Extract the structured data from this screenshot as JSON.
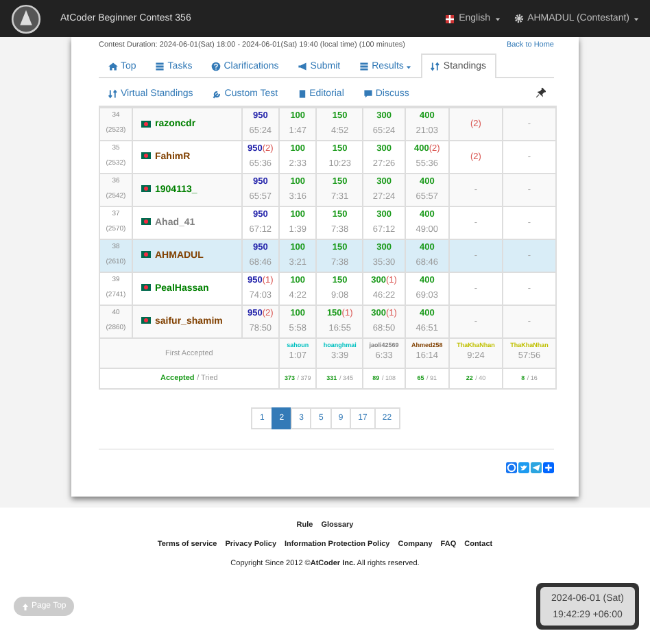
{
  "navbar": {
    "title": "AtCoder Beginner Contest 356",
    "language": "English",
    "user": "AHMADUL (Contestant)"
  },
  "contest_duration": "Contest Duration: 2024-06-01(Sat) 18:00 - 2024-06-01(Sat) 19:40 (local time) (100 minutes)",
  "back_link": "Back to Home",
  "tabs": [
    {
      "label": "Top",
      "kind": "home",
      "selected": false,
      "dropdown": false
    },
    {
      "label": "Tasks",
      "kind": "list",
      "selected": false,
      "dropdown": false
    },
    {
      "label": "Clarifications",
      "kind": "question",
      "selected": false,
      "dropdown": false
    },
    {
      "label": "Submit",
      "kind": "send",
      "selected": false,
      "dropdown": false
    },
    {
      "label": "Results",
      "kind": "list",
      "selected": false,
      "dropdown": true
    },
    {
      "label": "Standings",
      "kind": "sort",
      "selected": true,
      "dropdown": false
    }
  ],
  "subtabs": [
    {
      "label": "Virtual Standings",
      "kind": "sort"
    },
    {
      "label": "Custom Test",
      "kind": "wrench"
    },
    {
      "label": "Editorial",
      "kind": "book"
    },
    {
      "label": "Discuss",
      "kind": "comment"
    }
  ],
  "rows": [
    {
      "rank": "34",
      "rating": "(2523)",
      "user": "razoncdr",
      "color": "#008000",
      "highlighted": false,
      "total": {
        "score": "950",
        "time": "65:24"
      },
      "tasks": [
        {
          "kind": "solved",
          "score": "100",
          "time": "1:47"
        },
        {
          "kind": "solved",
          "score": "150",
          "time": "4:52"
        },
        {
          "kind": "solved",
          "score": "300",
          "time": "65:24"
        },
        {
          "kind": "solved",
          "score": "400",
          "time": "21:03"
        },
        {
          "kind": "tried",
          "penalty": "(2)"
        },
        {
          "kind": "none",
          "text": "-"
        }
      ]
    },
    {
      "rank": "35",
      "rating": "(2532)",
      "user": "FahimR",
      "color": "#804000",
      "highlighted": false,
      "total": {
        "score": "950",
        "penalty": "(2)",
        "time": "65:36"
      },
      "tasks": [
        {
          "kind": "solved",
          "score": "100",
          "time": "2:33"
        },
        {
          "kind": "solved",
          "score": "150",
          "time": "10:23"
        },
        {
          "kind": "solved",
          "score": "300",
          "time": "27:26"
        },
        {
          "kind": "solved",
          "score": "400",
          "penalty": "(2)",
          "time": "55:36"
        },
        {
          "kind": "tried",
          "penalty": "(2)"
        },
        {
          "kind": "none",
          "text": "-"
        }
      ]
    },
    {
      "rank": "36",
      "rating": "(2542)",
      "user": "1904113_",
      "color": "#008000",
      "highlighted": false,
      "total": {
        "score": "950",
        "time": "65:57"
      },
      "tasks": [
        {
          "kind": "solved",
          "score": "100",
          "time": "3:16"
        },
        {
          "kind": "solved",
          "score": "150",
          "time": "7:31"
        },
        {
          "kind": "solved",
          "score": "300",
          "time": "27:24"
        },
        {
          "kind": "solved",
          "score": "400",
          "time": "65:57"
        },
        {
          "kind": "none",
          "text": "-"
        },
        {
          "kind": "none",
          "text": "-"
        }
      ]
    },
    {
      "rank": "37",
      "rating": "(2570)",
      "user": "Ahad_41",
      "color": "#808080",
      "highlighted": false,
      "total": {
        "score": "950",
        "time": "67:12"
      },
      "tasks": [
        {
          "kind": "solved",
          "score": "100",
          "time": "1:39"
        },
        {
          "kind": "solved",
          "score": "150",
          "time": "7:38"
        },
        {
          "kind": "solved",
          "score": "300",
          "time": "67:12"
        },
        {
          "kind": "solved",
          "score": "400",
          "time": "49:00"
        },
        {
          "kind": "none",
          "text": "-"
        },
        {
          "kind": "none",
          "text": "-"
        }
      ]
    },
    {
      "rank": "38",
      "rating": "(2610)",
      "user": "AHMADUL",
      "color": "#804000",
      "highlighted": true,
      "total": {
        "score": "950",
        "time": "68:46"
      },
      "tasks": [
        {
          "kind": "solved",
          "score": "100",
          "time": "3:21"
        },
        {
          "kind": "solved",
          "score": "150",
          "time": "7:38"
        },
        {
          "kind": "solved",
          "score": "300",
          "time": "35:30"
        },
        {
          "kind": "solved",
          "score": "400",
          "time": "68:46"
        },
        {
          "kind": "none",
          "text": "-"
        },
        {
          "kind": "none",
          "text": "-"
        }
      ]
    },
    {
      "rank": "39",
      "rating": "(2741)",
      "user": "PealHassan",
      "color": "#008000",
      "highlighted": false,
      "total": {
        "score": "950",
        "penalty": "(1)",
        "time": "74:03"
      },
      "tasks": [
        {
          "kind": "solved",
          "score": "100",
          "time": "4:22"
        },
        {
          "kind": "solved",
          "score": "150",
          "time": "9:08"
        },
        {
          "kind": "solved",
          "score": "300",
          "penalty": "(1)",
          "time": "46:22"
        },
        {
          "kind": "solved",
          "score": "400",
          "time": "69:03"
        },
        {
          "kind": "none",
          "text": "-"
        },
        {
          "kind": "none",
          "text": "-"
        }
      ]
    },
    {
      "rank": "40",
      "rating": "(2860)",
      "user": "saifur_shamim",
      "color": "#804000",
      "highlighted": false,
      "total": {
        "score": "950",
        "penalty": "(2)",
        "time": "78:50"
      },
      "tasks": [
        {
          "kind": "solved",
          "score": "100",
          "time": "5:58"
        },
        {
          "kind": "solved",
          "score": "150",
          "penalty": "(1)",
          "time": "16:55"
        },
        {
          "kind": "solved",
          "score": "300",
          "penalty": "(1)",
          "time": "68:50"
        },
        {
          "kind": "solved",
          "score": "400",
          "time": "46:51"
        },
        {
          "kind": "none",
          "text": "-"
        },
        {
          "kind": "none",
          "text": "-"
        }
      ]
    }
  ],
  "first_accepted": {
    "label": "First Accepted",
    "entries": [
      {
        "user": "sahoun",
        "color": "#00c0c0",
        "time": "1:07"
      },
      {
        "user": "hoanghmai",
        "color": "#00c0c0",
        "time": "3:39"
      },
      {
        "user": "jaoli42569",
        "color": "#808080",
        "time": "6:33"
      },
      {
        "user": "Ahmed258",
        "color": "#804000",
        "time": "16:14"
      },
      {
        "user": "ThaKhaNhan",
        "color": "#c0c000",
        "time": "9:24"
      },
      {
        "user": "ThaKhaNhan",
        "color": "#c0c000",
        "time": "57:56"
      }
    ]
  },
  "accepted_tried": {
    "accepted_label": "Accepted",
    "tried_label": "/ Tried",
    "entries": [
      {
        "accepted": "373",
        "tried": "/ 379"
      },
      {
        "accepted": "331",
        "tried": "/ 345"
      },
      {
        "accepted": "89",
        "tried": "/ 108"
      },
      {
        "accepted": "65",
        "tried": "/ 91"
      },
      {
        "accepted": "22",
        "tried": "/ 40"
      },
      {
        "accepted": "8",
        "tried": "/ 16"
      }
    ]
  },
  "pages": [
    {
      "label": "1",
      "selected": false
    },
    {
      "label": "2",
      "selected": true
    },
    {
      "label": "3",
      "selected": false
    },
    {
      "label": "5",
      "selected": false
    },
    {
      "label": "9",
      "selected": false
    },
    {
      "label": "17",
      "selected": false
    },
    {
      "label": "22",
      "selected": false
    }
  ],
  "footer": {
    "links_top": [
      "Rule",
      "Glossary"
    ],
    "links": [
      "Terms of service",
      "Privacy Policy",
      "Information Protection Policy",
      "Company",
      "FAQ",
      "Contact"
    ],
    "copyright": "Copyright Since 2012 ©**AtCoder Inc.** All rights reserved."
  },
  "page_top": "Page Top",
  "clock": {
    "date": "2024-06-01 (Sat)",
    "time": "19:42:29 +06:00"
  }
}
